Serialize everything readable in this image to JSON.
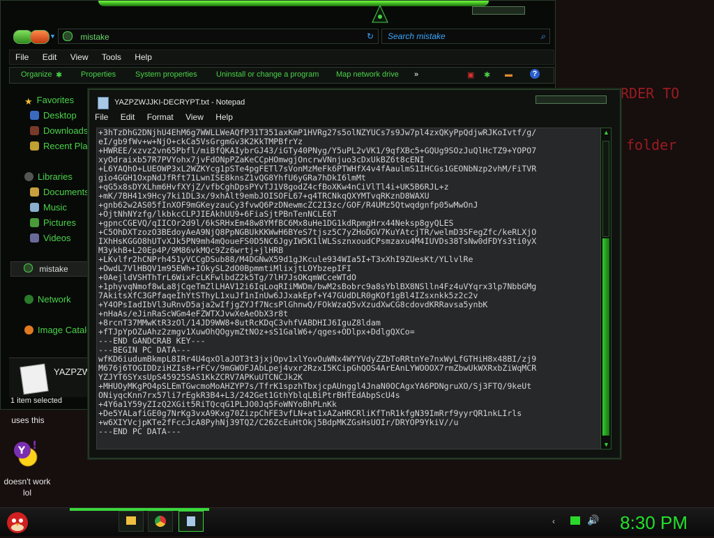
{
  "desktop": {
    "text1": "RDER TO",
    "text2": "folder",
    "yahoo_caption_top": "uses this",
    "yahoo_caption_line1": "doesn't work",
    "yahoo_caption_line2": "lol"
  },
  "explorer": {
    "address": "mistake",
    "search_placeholder": "Search mistake",
    "menu": [
      "File",
      "Edit",
      "View",
      "Tools",
      "Help"
    ],
    "commands": [
      "Organize",
      "Properties",
      "System properties",
      "Uninstall or change a program",
      "Map network drive",
      "»"
    ],
    "sidebar": {
      "favorites": "Favorites",
      "desktop": "Desktop",
      "downloads": "Downloads",
      "recent": "Recent Pla",
      "libraries": "Libraries",
      "documents": "Documents",
      "music": "Music",
      "pictures": "Pictures",
      "videos": "Videos",
      "mistake": "mistake",
      "network": "Network",
      "image_catalog": "Image Catalo"
    },
    "details_name": "YAZPZW",
    "status": "1 item selected"
  },
  "notepad": {
    "title": "YAZPZWJJKI-DECRYPT.txt - Notepad",
    "menu": [
      "File",
      "Edit",
      "Format",
      "View",
      "Help"
    ],
    "lines": [
      "+3hTzDhG2DNjhU4EhM6g7WWLLWeAQfP31T351axKmP1HVRg27s5olNZYUCs7s9Jw7pl4zxQKyPpQdjwRJKoIvtf/g/",
      "eI/gb9fWv+w+NjO+ckCa5VsGrgmGv3K2KkTMPBfrYz",
      "+HWREE/xzvz2vn65Pbfl/miBfQKAIybrGJ43/iGTy40PNyg/Y5uPL2vVK1/9qfXBc5+GQUg9SOzJuQlHcTZ9+YOPO7",
      "xyOdraixb57R7PVYohx7jvFdONpPZaKeCCpHOmwgjOncrwVNnjuo3cDxUkBZ6t8cENI",
      "+L6YAQhO+LUEOWP3xL2WZKYcg1pSTe4pgFETl7sVonMzMeFk6PTWHfX4v4fAaulmS1IHCGs1GEONbNzp2vhM/FiTVR",
      "gio4GGH1OxpNdJfRft71LwnISE8knsZ1vQG8YhfU6yGRa7hDkI6lmMt",
      "+qG5x8sDYXLhm6HvfXYjZ/vfbCghDpsPYvTJ1V8godZ4cfBoXKw4nCiVlTl4i+UK5B6RJL+z",
      "+mK/7BH41x9Hcy7ki1DL3x/9xhAlt9embJOISOFL67+q4TRCNkqQXYMTvqRKznD8WAXU",
      "+gnb62w2AS05fInXOF9mGKeyzauCy3fvwQ6PzDNewmcZC2I3zc/GOF/R4UMz5Qtwqdgnfp05wMwOnJ",
      "+OjtNhNYzfg/lkbkcCLPJIEAkhUU9+6FiaSjtPBnTenNCLE6T",
      "+gpncCGEVQ/qIICOr2d9l/6kSRHxEm48w8YMfBC6Mx8uHe1DG1kdRpmgHrx44Neksp8gyQLES",
      "+C5OhDXTzozO3BEdoyAeA9NjQ8PpNGBUkKKWwH6BYeS7tjsz5C7yZHoDGV7KuYAtcjTR/welmD3SFegZfc/keRLXjO",
      "IXhHsKGGO8hUTvXJk5PN9mh4mQoueFS0D5NC6JgyIW5K1lWLSsznxoudCPsmzaxu4M4IUVDs38TsNw0dFDYs3ti0yX",
      "M3ykhB+L20Ep4P/9M86vkMQc9Zz6wrtj+jlHRB",
      "+LKvlfr2hCNPrh451yVCCgDSub88/M4DGNwX59d1gJKcule934WIa5I+T3xXhI9ZUesKt/YLlvlRe",
      "+OwdL7VlHBQV1m95EWh+IOkySL2dO0BpmmtiMlixjtLOYbzepIFI",
      "+0AejldVSHThTrL6WixFcLKFwlbdZ2k5Tg/7lH7JsOKqmWCceWTdO",
      "+1phyvqNmof8wLa8jCqeTmZlLHAV12i6IqLoqRIiMWDm/bwM2sBobrc9a8sYblBX8NSlln4Fz4uVYqrx3lp7NbbGMg",
      "7AkitsXfC3GPfaqeIhYtSThyL1xuJf1nInUw6JJxakEpf+Y47GUdDLR0gKOf1gBl4IZsxnkk5z2c2v",
      "+Y4OPsIadIbVl3uRnvD5aja2wIfjgZYJf7NcsPlGhnwQ/FOkWzaQ5vXzudXwCG8cdovdKRRavsa5ynbK",
      "+nHaAs/eJinRaScWGm4eFZWTXJvwXeAeObX3r8t",
      "+8rcnT37MMwKtR3zOl/14JD9WW8+8utRcKDqC3vhfVABDHIJ6IguZ8ldam",
      "+fTJpYpOZuAhz2zmgv1XuwOhQOgymZtNOz+sS1GalW6+/qges+ODlpx+DdlgQXCo=",
      "---END GANDCRAB KEY---",
      "",
      "---BEGIN PC DATA---",
      "wfKD6iudumBkmpL8IRr4U4qxOlaJOT3t3jxjOpv1xlYovOuWNx4WYYVdyZZbToRRtnYe7nxWyLfGTHiH8x48BI/zj9",
      "M676j6TOGIDDziHZIs8+rFCv/9mGWOFJAbLpej4vxr2RzxI5KCipGhQOS4ArEAnLYWOOOX7rmZbwUkWXRxbZiWqMCR",
      "YZJYT6SYxsUpS45925SAS1KkZCRV7APKuUTCNCJk2K",
      "+MHUOyMKgPO4pSLEmTGwcmoMoAHZYP7s/TfrK1spzhTbxjcpAUnggl4JnaN0OCAgxYA6PDNgruXO/Sj3FTQ/9keUt",
      "ONiyqcKnn7rx57li7rEgkR3B4+L3/242Get1GthYblqLBiPtrBHTEdAbpScU4s",
      "+4Y6a1Y59yZIzQ2XGit5RiTQcqG1PLJO0Jq5FoWNYoBhPLnKk",
      "+De5YALafiGE0g7NrKg3vxA9Kxg70ZizpChFE3vfLN+at1xAZaHRCRliKfTnR1kfgN39ImRrf9yyrQR1nkLIrls",
      "+w6XIYVcjpKTe2fFccJcA8PyhNj39TQ2/C26ZcEuHtOkj5BdpMKZGsHsUOIr/DRYOP9YkiV//u",
      "---END PC DATA---"
    ]
  },
  "taskbar": {
    "clock": "8:30 PM"
  },
  "colors": {
    "accent": "#22e02a",
    "sidebar_text": "#4ad24a",
    "desktop_red": "#9a1c20"
  }
}
